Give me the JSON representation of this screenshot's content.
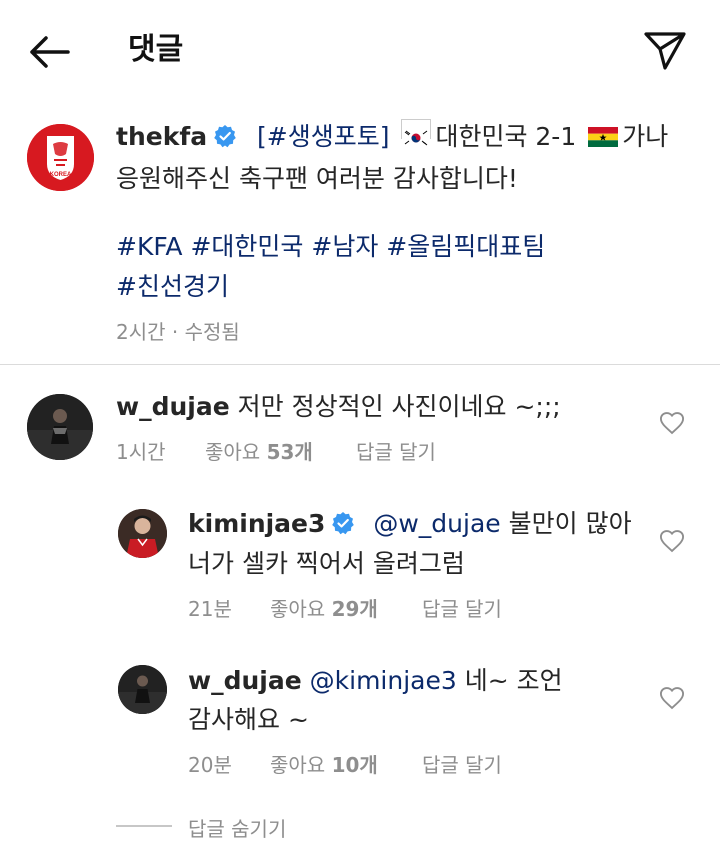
{
  "header": {
    "title": "댓글"
  },
  "post": {
    "username": "thekfa",
    "line1_tag": "[#생생포토]",
    "line1_team1": "대한민국 2-1",
    "line1_team2": "가나",
    "line2": "응원해주신 축구팬 여러분 감사합니다!",
    "hashtags1": [
      "#KFA",
      "#대한민국",
      "#남자",
      "#올림픽대표팀"
    ],
    "hashtags2": [
      "#친선경기"
    ],
    "time": "2시간",
    "edited": "· 수정됨",
    "avatar_text": "KOREA"
  },
  "comments": [
    {
      "username": "w_dujae",
      "text": "저만 정상적인 사진이네요 ~;;;",
      "time": "1시간",
      "likes_prefix": "좋아요",
      "likes": "53개",
      "reply": "답글 달기"
    }
  ],
  "replies": [
    {
      "username": "kiminjae3",
      "mention": "@w_dujae",
      "text_part1": "불만이 많아",
      "text_part2": "너가 셀카 찍어서 올려그럼",
      "time": "21분",
      "likes_prefix": "좋아요",
      "likes": "29개",
      "reply": "답글 달기"
    },
    {
      "username": "w_dujae",
      "mention": "@kiminjae3",
      "text_part1": "네~ 조언",
      "text_part2": "감사해요 ~",
      "time": "20분",
      "likes_prefix": "좋아요",
      "likes": "10개",
      "reply": "답글 달기"
    }
  ],
  "hide_replies": "답글 숨기기",
  "colors": {
    "hashtag": "#0c2a6b",
    "verified": "#3897f0",
    "kfa_red": "#d71920",
    "meta": "#8e8e8e"
  }
}
